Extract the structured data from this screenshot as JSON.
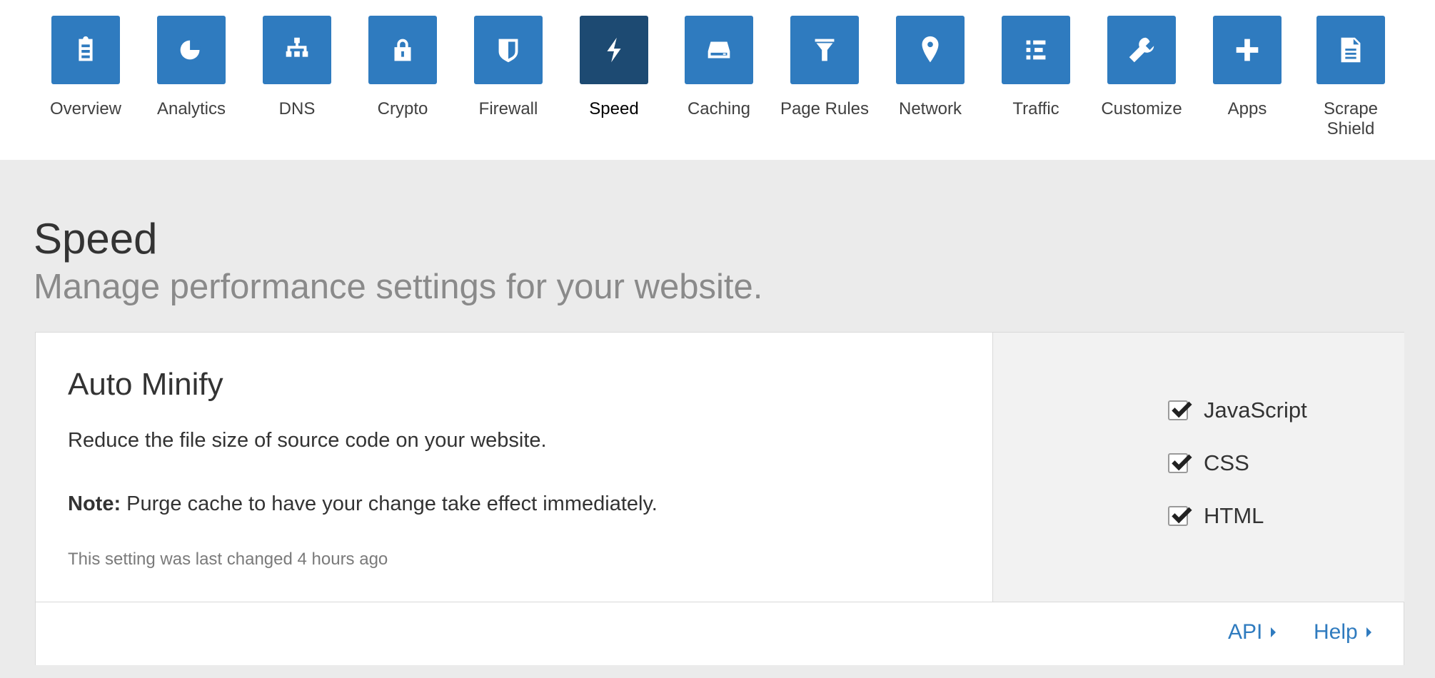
{
  "nav": {
    "items": [
      {
        "label": "Overview",
        "icon": "clipboard-icon"
      },
      {
        "label": "Analytics",
        "icon": "pie-chart-icon"
      },
      {
        "label": "DNS",
        "icon": "sitemap-icon"
      },
      {
        "label": "Crypto",
        "icon": "lock-icon"
      },
      {
        "label": "Firewall",
        "icon": "shield-icon"
      },
      {
        "label": "Speed",
        "icon": "lightning-bolt-icon"
      },
      {
        "label": "Caching",
        "icon": "drive-icon"
      },
      {
        "label": "Page Rules",
        "icon": "filter-icon"
      },
      {
        "label": "Network",
        "icon": "map-pin-icon"
      },
      {
        "label": "Traffic",
        "icon": "list-icon"
      },
      {
        "label": "Customize",
        "icon": "wrench-icon"
      },
      {
        "label": "Apps",
        "icon": "plus-icon"
      },
      {
        "label": "Scrape Shield",
        "icon": "document-icon"
      }
    ],
    "active": "Speed",
    "colors": {
      "tile": "#2f7bbf",
      "tile_active": "#1d4a72"
    }
  },
  "page": {
    "title": "Speed",
    "subtitle": "Manage performance settings for your website."
  },
  "card": {
    "title": "Auto Minify",
    "description": "Reduce the file size of source code on your website.",
    "note_label": "Note:",
    "note_text": " Purge cache to have your change take effect immediately.",
    "last_changed": "This setting was last changed 4 hours ago",
    "options": [
      {
        "label": "JavaScript",
        "checked": true
      },
      {
        "label": "CSS",
        "checked": true
      },
      {
        "label": "HTML",
        "checked": true
      }
    ],
    "footer": {
      "api_label": "API",
      "help_label": "Help"
    }
  }
}
